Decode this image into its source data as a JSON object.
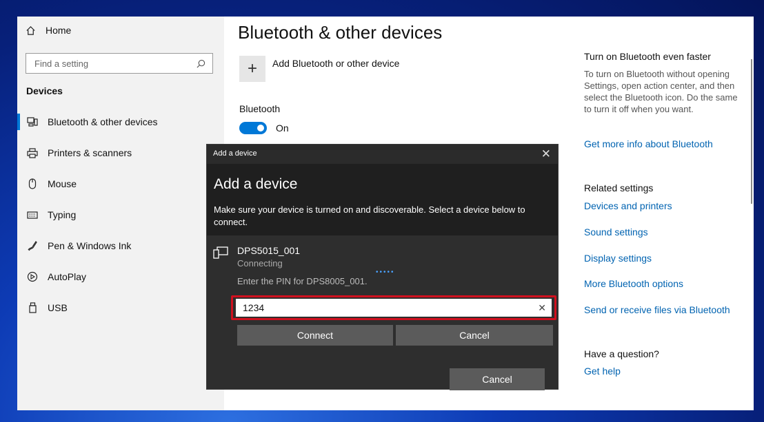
{
  "sidebar": {
    "home_label": "Home",
    "search_placeholder": "Find a setting",
    "section_title": "Devices",
    "items": [
      {
        "label": "Bluetooth & other devices",
        "icon": "bluetooth-devices-icon"
      },
      {
        "label": "Printers & scanners",
        "icon": "printer-icon"
      },
      {
        "label": "Mouse",
        "icon": "mouse-icon"
      },
      {
        "label": "Typing",
        "icon": "keyboard-icon"
      },
      {
        "label": "Pen & Windows Ink",
        "icon": "pen-icon"
      },
      {
        "label": "AutoPlay",
        "icon": "autoplay-icon"
      },
      {
        "label": "USB",
        "icon": "usb-icon"
      }
    ]
  },
  "main": {
    "title": "Bluetooth & other devices",
    "add_label": "Add Bluetooth or other device",
    "bluetooth_label": "Bluetooth",
    "toggle_state": "On"
  },
  "right": {
    "faster_heading": "Turn on Bluetooth even faster",
    "faster_text": "To turn on Bluetooth without opening Settings, open action center, and then select the Bluetooth icon. Do the same to turn it off when you want.",
    "more_info_link": "Get more info about Bluetooth",
    "related_heading": "Related settings",
    "related_links": [
      "Devices and printers",
      "Sound settings",
      "Display settings",
      "More Bluetooth options",
      "Send or receive files via Bluetooth"
    ],
    "question_heading": "Have a question?",
    "help_link": "Get help"
  },
  "dialog": {
    "window_title": "Add a device",
    "heading": "Add a device",
    "description": "Make sure your device is turned on and discoverable. Select a device below to connect.",
    "device_name": "DPS5015_001",
    "device_status": "Connecting",
    "pin_prompt": "Enter the PIN for DPS8005_001.",
    "pin_value": "1234",
    "connect_label": "Connect",
    "cancel_label": "Cancel",
    "bottom_cancel_label": "Cancel"
  },
  "colors": {
    "accent": "#0078d7",
    "link": "#0063b1",
    "highlight": "#d0101e"
  }
}
